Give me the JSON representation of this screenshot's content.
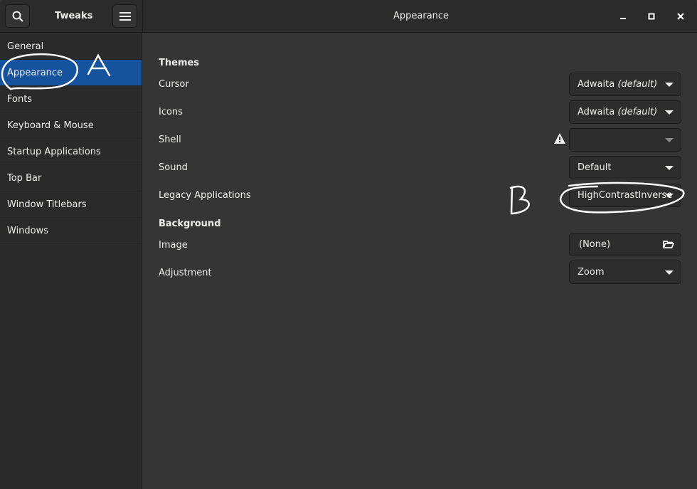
{
  "header": {
    "app_title": "Tweaks",
    "page_title": "Appearance",
    "search_icon": "search-icon",
    "menu_icon": "hamburger-menu-icon"
  },
  "sidebar": {
    "items": [
      {
        "label": "General"
      },
      {
        "label": "Appearance",
        "selected": true
      },
      {
        "label": "Fonts"
      },
      {
        "label": "Keyboard & Mouse"
      },
      {
        "label": "Startup Applications"
      },
      {
        "label": "Top Bar"
      },
      {
        "label": "Window Titlebars"
      },
      {
        "label": "Windows"
      }
    ]
  },
  "themes": {
    "heading": "Themes",
    "cursor": {
      "label": "Cursor",
      "value": "Adwaita",
      "suffix": "(default)"
    },
    "icons": {
      "label": "Icons",
      "value": "Adwaita",
      "suffix": "(default)"
    },
    "shell": {
      "label": "Shell",
      "value": "",
      "warning_icon": "warning-icon"
    },
    "sound": {
      "label": "Sound",
      "value": "Default"
    },
    "legacy": {
      "label": "Legacy Applications",
      "value": "HighContrastInverse"
    }
  },
  "background": {
    "heading": "Background",
    "image": {
      "label": "Image",
      "value": "(None)",
      "icon": "folder-open-icon"
    },
    "adjustment": {
      "label": "Adjustment",
      "value": "Zoom"
    }
  },
  "annotations": {
    "a": "A",
    "b": "B"
  },
  "colors": {
    "accent": "#15539e",
    "header": "#2b2b2b",
    "main": "#353535"
  }
}
